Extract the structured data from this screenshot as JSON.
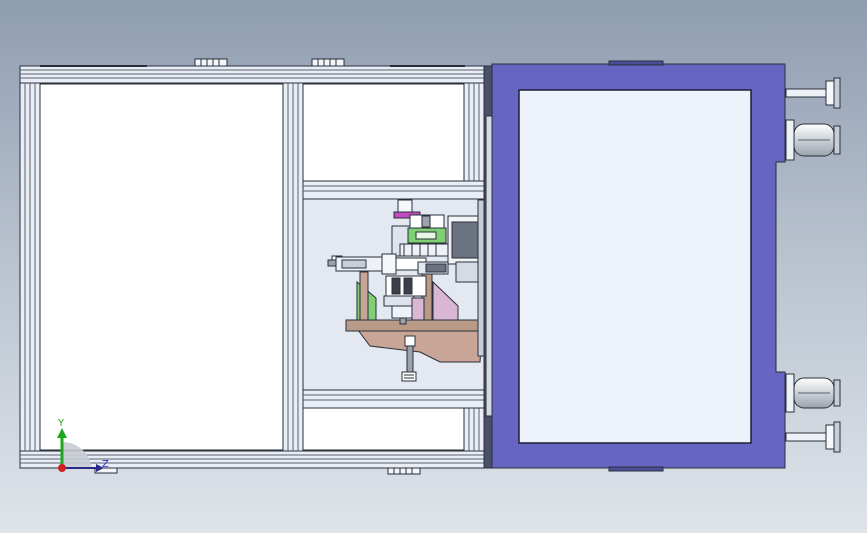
{
  "viewport": {
    "background_top": "#8f9db1",
    "background_bottom": "#dfe4ea"
  },
  "triad": {
    "y_label": "Y",
    "z_label": "Z",
    "y_color": "#1fa81f",
    "z_color": "#2a2ad8",
    "origin_color": "#d02020"
  },
  "colors": {
    "frame_fill": "#e6ebf3",
    "frame_line": "#2a2f3a",
    "door_fill": "#6666c2",
    "glass_fill": "#eef2fb",
    "wood": "#b99a86",
    "machine_green": "#7fcf73",
    "machine_magenta": "#c24bc2"
  }
}
